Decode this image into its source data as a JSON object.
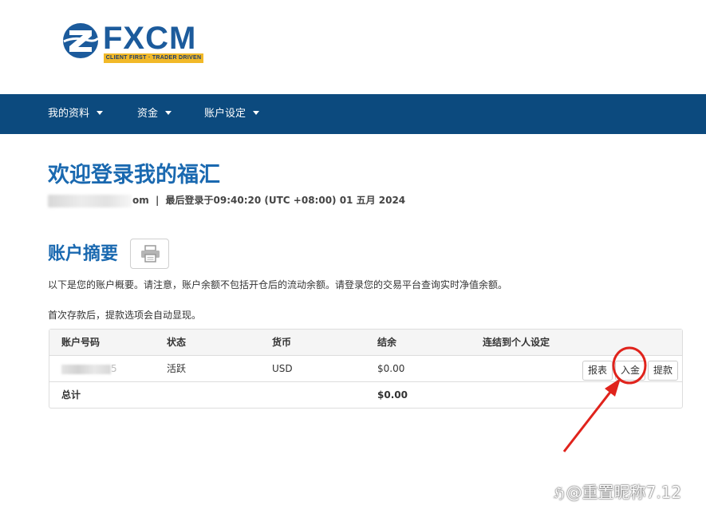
{
  "brand": {
    "name": "FXCM",
    "tagline": "CLIENT FIRST · TRADER DRIVEN",
    "colors": {
      "primary": "#1c5b9c",
      "tagline_bg": "#f2b928",
      "nav_bg": "#0c4a7e",
      "heading": "#1a69b0"
    }
  },
  "nav": {
    "items": [
      {
        "label": "我的资料"
      },
      {
        "label": "资金"
      },
      {
        "label": "账户设定"
      }
    ]
  },
  "welcome": {
    "title": "欢迎登录我的福汇",
    "email_suffix": "om",
    "separator": "|",
    "last_login": "最后登录于09:40:20 (UTC +08:00) 01 五月 2024"
  },
  "summary": {
    "title": "账户摘要",
    "print_icon": "printer-icon",
    "description": "以下是您的账户概要。请注意，账户余额不包括开仓后的流动余额。请登录您的交易平台查询实时净值余额。",
    "note": "首次存款后，提款选项会自动显现。"
  },
  "table": {
    "headers": [
      "账户号码",
      "状态",
      "货币",
      "结余",
      "连结到个人设定"
    ],
    "rows": [
      {
        "account_suffix": "5",
        "status": "活跃",
        "currency": "USD",
        "balance": "$0.00",
        "actions": [
          "报表",
          "入金",
          "提款"
        ]
      }
    ],
    "total": {
      "label": "总计",
      "balance": "$0.00"
    }
  },
  "annotation": {
    "highlight_color": "#e0231c",
    "watermark": "@重置昵称7.12"
  }
}
